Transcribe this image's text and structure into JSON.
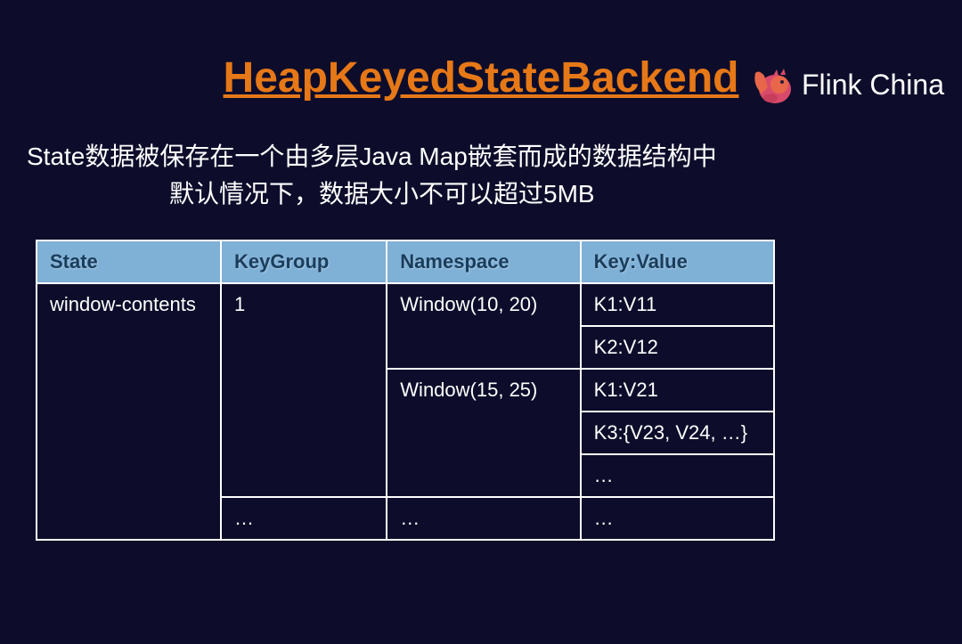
{
  "brand": "Flink China",
  "title": "HeapKeyedStateBackend",
  "description": {
    "line1": "State数据被保存在一个由多层Java Map嵌套而成的数据结构中",
    "line2": "默认情况下，数据大小不可以超过5MB"
  },
  "table": {
    "headers": {
      "state": "State",
      "keygroup": "KeyGroup",
      "namespace": "Namespace",
      "keyvalue": "Key:Value"
    },
    "cells": {
      "state_val": "window-contents",
      "keygroup_val": "1",
      "namespace_1": "Window(10, 20)",
      "namespace_2": "Window(15, 25)",
      "kv_1": "K1:V11",
      "kv_2": "K2:V12",
      "kv_3": "K1:V21",
      "kv_4": "K3:{V23, V24, …}",
      "kv_5": "…",
      "ellipsis": "…"
    }
  }
}
